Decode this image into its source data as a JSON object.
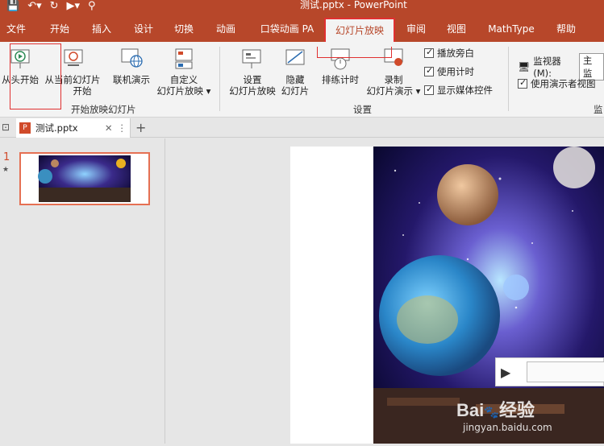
{
  "window": {
    "title": "测试.pptx  -  PowerPoint"
  },
  "tabs": [
    "文件",
    "开始",
    "插入",
    "设计",
    "切换",
    "动画",
    "口袋动画 PA",
    "幻灯片放映",
    "审阅",
    "视图",
    "MathType",
    "帮助"
  ],
  "ribbon": {
    "from_beginning": "从头开始",
    "from_current": "从当前幻灯片开始",
    "from_current_l1": "从当前幻灯片",
    "from_current_l2": "开始",
    "online_present": "联机演示",
    "custom_show_l1": "自定义",
    "custom_show_l2": "幻灯片放映",
    "setup_show_l1": "设置",
    "setup_show_l2": "幻灯片放映",
    "hide_slide_l1": "隐藏",
    "hide_slide_l2": "幻灯片",
    "rehearse": "排练计时",
    "record_l1": "录制",
    "record_l2": "幻灯片演示",
    "play_narrations": "播放旁白",
    "use_timings": "使用计时",
    "show_media_controls": "显示媒体控件",
    "monitor_label": "监视器(M):",
    "monitor_value": "主监",
    "use_presenter_view": "使用演示者视图",
    "group_start": "开始放映幻灯片",
    "group_setup": "设置",
    "group_monitor": "监"
  },
  "document": {
    "tab_name": "测试.pptx",
    "slide_number": "1",
    "slide_star": "★"
  },
  "watermark": {
    "brand": "Bai",
    "brand2": "经验",
    "url": "jingyan.baidu.com"
  }
}
